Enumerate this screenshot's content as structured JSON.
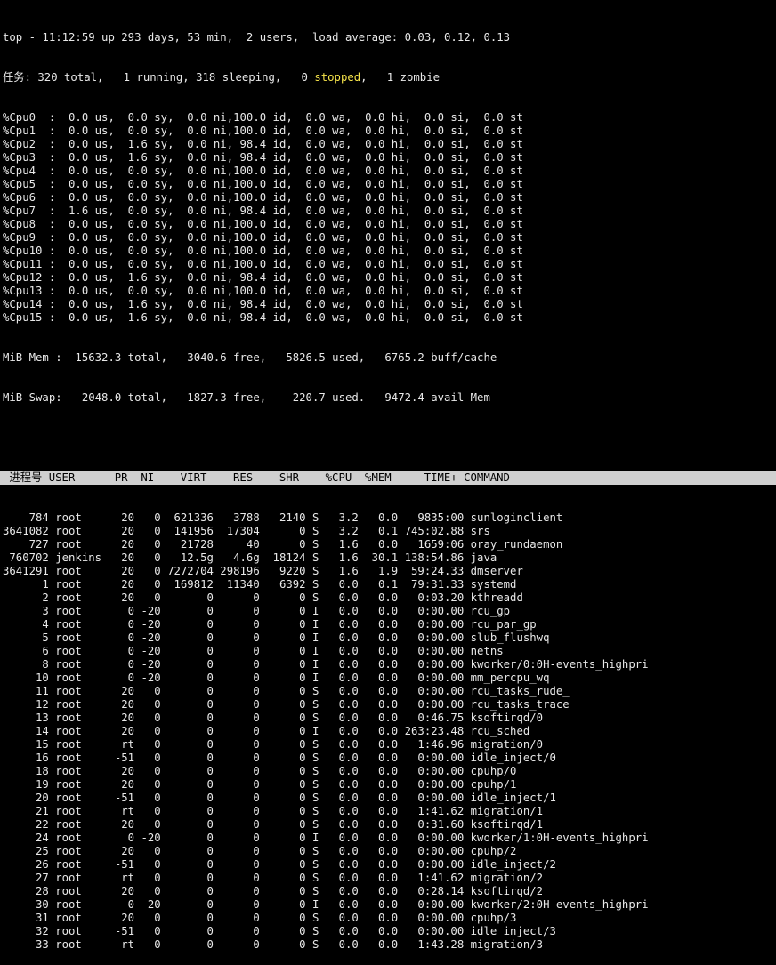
{
  "summary": {
    "top_line": "top - 11:12:59 up 293 days, 53 min,  2 users,  load average: 0.03, 0.12, 0.13",
    "tasks_prefix": "任务: 320 total,   1 running, 318 sleeping,   0 ",
    "tasks_stopped": "stopped",
    "tasks_suffix": ",   1 zombie",
    "cpus": [
      "%Cpu0  :  0.0 us,  0.0 sy,  0.0 ni,100.0 id,  0.0 wa,  0.0 hi,  0.0 si,  0.0 st",
      "%Cpu1  :  0.0 us,  0.0 sy,  0.0 ni,100.0 id,  0.0 wa,  0.0 hi,  0.0 si,  0.0 st",
      "%Cpu2  :  0.0 us,  1.6 sy,  0.0 ni, 98.4 id,  0.0 wa,  0.0 hi,  0.0 si,  0.0 st",
      "%Cpu3  :  0.0 us,  1.6 sy,  0.0 ni, 98.4 id,  0.0 wa,  0.0 hi,  0.0 si,  0.0 st",
      "%Cpu4  :  0.0 us,  0.0 sy,  0.0 ni,100.0 id,  0.0 wa,  0.0 hi,  0.0 si,  0.0 st",
      "%Cpu5  :  0.0 us,  0.0 sy,  0.0 ni,100.0 id,  0.0 wa,  0.0 hi,  0.0 si,  0.0 st",
      "%Cpu6  :  0.0 us,  0.0 sy,  0.0 ni,100.0 id,  0.0 wa,  0.0 hi,  0.0 si,  0.0 st",
      "%Cpu7  :  1.6 us,  0.0 sy,  0.0 ni, 98.4 id,  0.0 wa,  0.0 hi,  0.0 si,  0.0 st",
      "%Cpu8  :  0.0 us,  0.0 sy,  0.0 ni,100.0 id,  0.0 wa,  0.0 hi,  0.0 si,  0.0 st",
      "%Cpu9  :  0.0 us,  0.0 sy,  0.0 ni,100.0 id,  0.0 wa,  0.0 hi,  0.0 si,  0.0 st",
      "%Cpu10 :  0.0 us,  0.0 sy,  0.0 ni,100.0 id,  0.0 wa,  0.0 hi,  0.0 si,  0.0 st",
      "%Cpu11 :  0.0 us,  0.0 sy,  0.0 ni,100.0 id,  0.0 wa,  0.0 hi,  0.0 si,  0.0 st",
      "%Cpu12 :  0.0 us,  1.6 sy,  0.0 ni, 98.4 id,  0.0 wa,  0.0 hi,  0.0 si,  0.0 st",
      "%Cpu13 :  0.0 us,  0.0 sy,  0.0 ni,100.0 id,  0.0 wa,  0.0 hi,  0.0 si,  0.0 st",
      "%Cpu14 :  0.0 us,  1.6 sy,  0.0 ni, 98.4 id,  0.0 wa,  0.0 hi,  0.0 si,  0.0 st",
      "%Cpu15 :  0.0 us,  1.6 sy,  0.0 ni, 98.4 id,  0.0 wa,  0.0 hi,  0.0 si,  0.0 st"
    ],
    "mem": "MiB Mem :  15632.3 total,   3040.6 free,   5826.5 used,   6765.2 buff/cache",
    "swap": "MiB Swap:   2048.0 total,   1827.3 free,    220.7 used.   9472.4 avail Mem"
  },
  "process_table": {
    "header": " 进程号 USER      PR  NI    VIRT    RES    SHR    %CPU  %MEM     TIME+ COMMAND",
    "rows": [
      "    784 root      20   0  621336   3788   2140 S   3.2   0.0   9835:00 sunloginclient",
      "3641082 root      20   0  141956  17304      0 S   3.2   0.1 745:02.88 srs",
      "    727 root      20   0   21728     40      0 S   1.6   0.0   1659:06 oray_rundaemon",
      " 760702 jenkins   20   0   12.5g   4.6g  18124 S   1.6  30.1 138:54.86 java",
      "3641291 root      20   0 7272704 298196   9220 S   1.6   1.9  59:24.33 dmserver",
      "      1 root      20   0  169812  11340   6392 S   0.0   0.1  79:31.33 systemd",
      "      2 root      20   0       0      0      0 S   0.0   0.0   0:03.20 kthreadd",
      "      3 root       0 -20       0      0      0 I   0.0   0.0   0:00.00 rcu_gp",
      "      4 root       0 -20       0      0      0 I   0.0   0.0   0:00.00 rcu_par_gp",
      "      5 root       0 -20       0      0      0 I   0.0   0.0   0:00.00 slub_flushwq",
      "      6 root       0 -20       0      0      0 I   0.0   0.0   0:00.00 netns",
      "      8 root       0 -20       0      0      0 I   0.0   0.0   0:00.00 kworker/0:0H-events_highpri",
      "     10 root       0 -20       0      0      0 I   0.0   0.0   0:00.00 mm_percpu_wq",
      "     11 root      20   0       0      0      0 S   0.0   0.0   0:00.00 rcu_tasks_rude_",
      "     12 root      20   0       0      0      0 S   0.0   0.0   0:00.00 rcu_tasks_trace",
      "     13 root      20   0       0      0      0 S   0.0   0.0   0:46.75 ksoftirqd/0",
      "     14 root      20   0       0      0      0 I   0.0   0.0 263:23.48 rcu_sched",
      "     15 root      rt   0       0      0      0 S   0.0   0.0   1:46.96 migration/0",
      "     16 root     -51   0       0      0      0 S   0.0   0.0   0:00.00 idle_inject/0",
      "     18 root      20   0       0      0      0 S   0.0   0.0   0:00.00 cpuhp/0",
      "     19 root      20   0       0      0      0 S   0.0   0.0   0:00.00 cpuhp/1",
      "     20 root     -51   0       0      0      0 S   0.0   0.0   0:00.00 idle_inject/1",
      "     21 root      rt   0       0      0      0 S   0.0   0.0   1:41.62 migration/1",
      "     22 root      20   0       0      0      0 S   0.0   0.0   0:31.60 ksoftirqd/1",
      "     24 root       0 -20       0      0      0 I   0.0   0.0   0:00.00 kworker/1:0H-events_highpri",
      "     25 root      20   0       0      0      0 S   0.0   0.0   0:00.00 cpuhp/2",
      "     26 root     -51   0       0      0      0 S   0.0   0.0   0:00.00 idle_inject/2",
      "     27 root      rt   0       0      0      0 S   0.0   0.0   1:41.62 migration/2",
      "     28 root      20   0       0      0      0 S   0.0   0.0   0:28.14 ksoftirqd/2",
      "     30 root       0 -20       0      0      0 I   0.0   0.0   0:00.00 kworker/2:0H-events_highpri",
      "     31 root      20   0       0      0      0 S   0.0   0.0   0:00.00 cpuhp/3",
      "     32 root     -51   0       0      0      0 S   0.0   0.0   0:00.00 idle_inject/3",
      "     33 root      rt   0       0      0      0 S   0.0   0.0   1:43.28 migration/3"
    ]
  },
  "colors": {
    "background": "#000000",
    "foreground": "#e8e8e8",
    "header_background": "#d0d0d0",
    "stopped_text": "#f5e34a"
  }
}
